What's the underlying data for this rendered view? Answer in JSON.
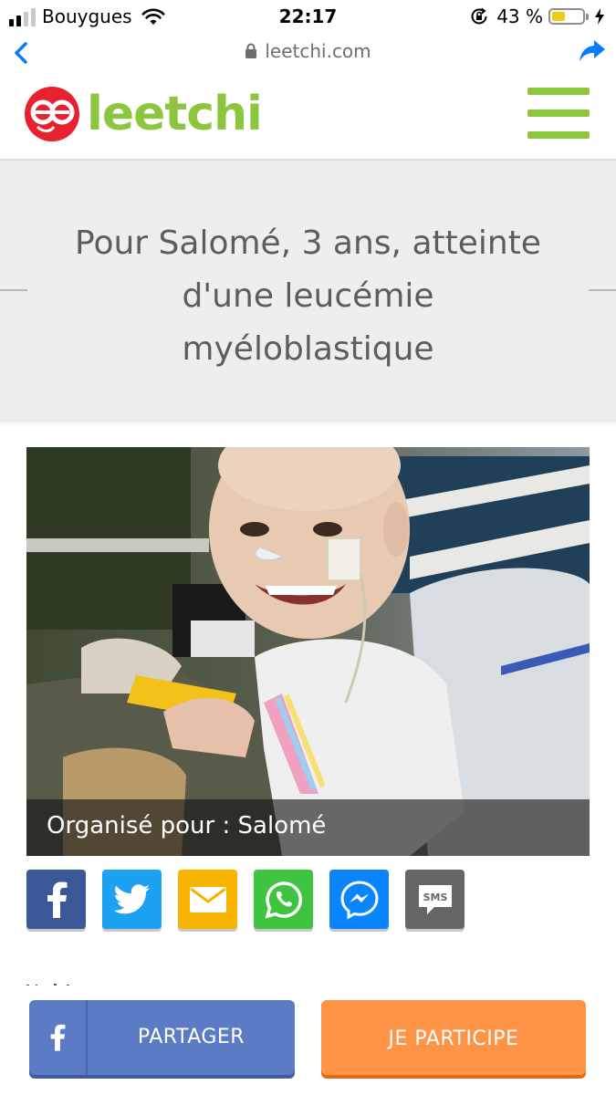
{
  "status_bar": {
    "carrier": "Bouygues",
    "time": "22:17",
    "battery_percent": "43 %",
    "battery_level": 0.43,
    "signal_bars_active": 2,
    "signal_bars_total": 4
  },
  "browser": {
    "url": "leetchi.com"
  },
  "header": {
    "logo_text": "leetchi"
  },
  "page": {
    "title_line1": "Pour Salomé, 3 ans, atteinte",
    "title_line2": "d'une leucémie",
    "title_line3": "myéloblastique",
    "photo_caption": "Organisé pour : Salomé"
  },
  "share_buttons": [
    {
      "network": "facebook",
      "icon": "facebook-icon",
      "color": "#3b5998"
    },
    {
      "network": "twitter",
      "icon": "twitter-icon",
      "color": "#1da1f2"
    },
    {
      "network": "email",
      "icon": "envelope-icon",
      "color": "#f6b300"
    },
    {
      "network": "whatsapp",
      "icon": "whatsapp-icon",
      "color": "#3fc441"
    },
    {
      "network": "messenger",
      "icon": "messenger-icon",
      "color": "#0a84ff"
    },
    {
      "network": "sms",
      "icon": "sms-icon",
      "color": "#666666",
      "label": "SMS"
    }
  ],
  "actions": {
    "share_label": "PARTAGER",
    "participate_label": "JE PARTICIPE"
  },
  "colors": {
    "brand_green": "#8cc63f",
    "brand_red": "#e8202f",
    "participate_orange": "#ff9447",
    "share_blue": "#5b7cc4",
    "ios_blue": "#0a7aff"
  }
}
